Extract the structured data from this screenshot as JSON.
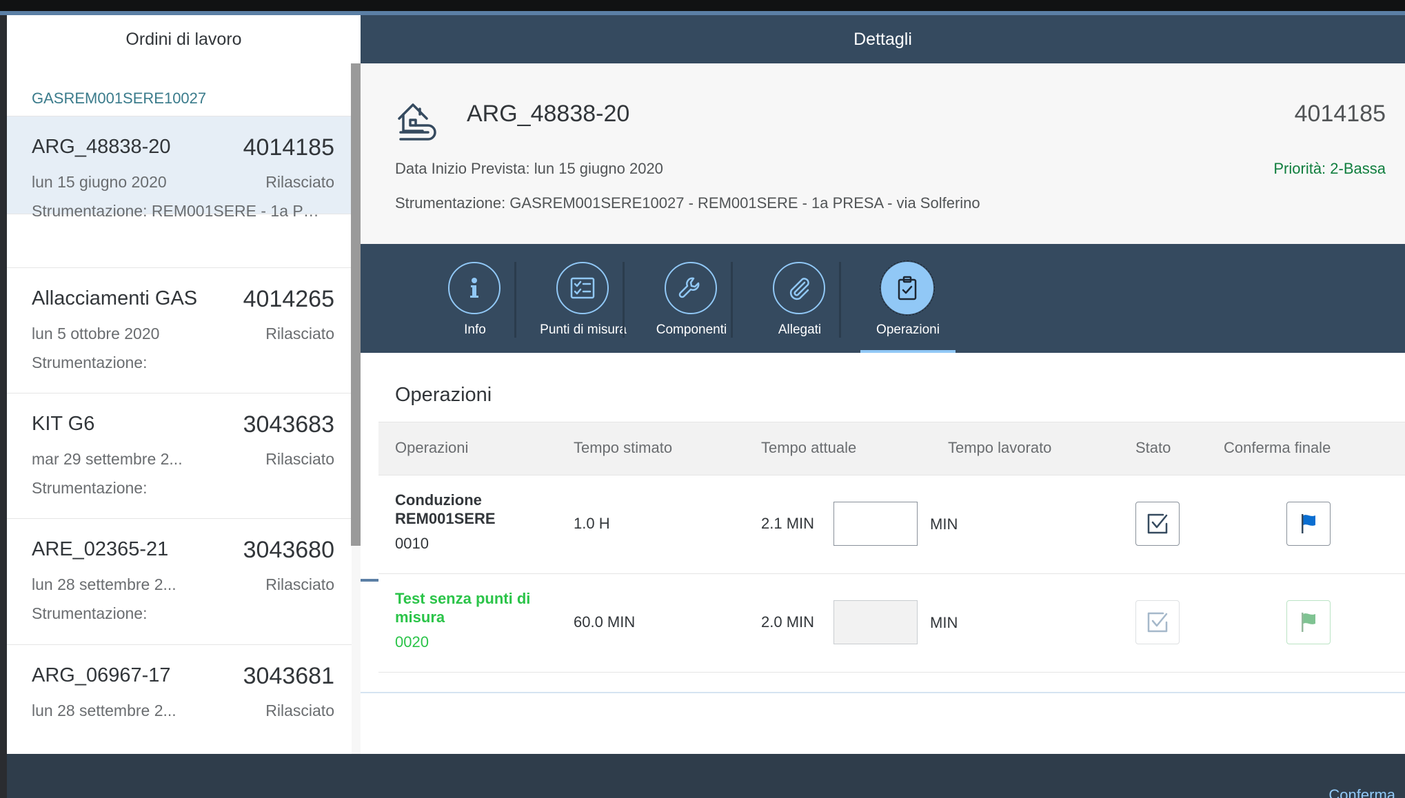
{
  "master": {
    "title": "Ordini di lavoro",
    "group_header": "GASREM001SERE10027",
    "items": [
      {
        "title": "ARG_48838-20",
        "number": "4014185",
        "date": "lun 15 giugno 2020",
        "status": "Rilasciato",
        "strumentazione": "Strumentazione: REM001SERE - 1a PRE..."
      },
      {
        "title": "Allacciamenti GAS",
        "number": "4014265",
        "date": "lun 5 ottobre 2020",
        "status": "Rilasciato",
        "strumentazione": "Strumentazione:"
      },
      {
        "title": "KIT G6",
        "number": "3043683",
        "date": "mar 29 settembre 2...",
        "status": "Rilasciato",
        "strumentazione": "Strumentazione:"
      },
      {
        "title": "ARE_02365-21",
        "number": "3043680",
        "date": "lun 28 settembre 2...",
        "status": "Rilasciato",
        "strumentazione": "Strumentazione:"
      },
      {
        "title": "ARG_06967-17",
        "number": "3043681",
        "date": "lun 28 settembre 2...",
        "status": "Rilasciato"
      }
    ]
  },
  "detail": {
    "title": "Dettagli",
    "object": {
      "title": "ARG_48838-20",
      "number": "4014185",
      "date": "Data Inizio Prevista: lun 15 giugno 2020",
      "priority": "Priorità: 2-Bassa",
      "strumentazione": "Strumentazione: GASREM001SERE10027 - REM001SERE - 1a PRESA - via Solferino",
      "icon": "house-pipe-icon"
    },
    "tabs": [
      {
        "label": "Info",
        "icon": "info-icon"
      },
      {
        "label": "Punti di misura",
        "icon": "checklist-icon"
      },
      {
        "label": "Componenti",
        "icon": "wrench-icon"
      },
      {
        "label": "Allegati",
        "icon": "paperclip-icon"
      },
      {
        "label": "Operazioni",
        "icon": "clipboard-check-icon",
        "active": true
      }
    ],
    "section_title": "Operazioni",
    "table": {
      "columns": [
        "Operazioni",
        "Tempo stimato",
        "Tempo attuale",
        "Tempo lavorato",
        "Stato",
        "Conferma finale"
      ],
      "rows": [
        {
          "name": "Conduzione REM001SERE",
          "code": "0010",
          "estimated": "1.0 H",
          "actual": "2.1 MIN",
          "worked": "",
          "unit": "MIN"
        },
        {
          "name": "Test senza punti di misura",
          "code": "0020",
          "estimated": "60.0 MIN",
          "actual": "2.0 MIN",
          "worked": "",
          "unit": "MIN"
        }
      ]
    },
    "footer": {
      "confirm_label": "Conferma"
    }
  },
  "colors": {
    "shell_header": "#354a5f",
    "accent": "#91c8f6",
    "group_header_text": "#3a7b8b",
    "priority": "#107e3e",
    "completed": "#2bc449",
    "selected_item": "#e6eef6"
  }
}
